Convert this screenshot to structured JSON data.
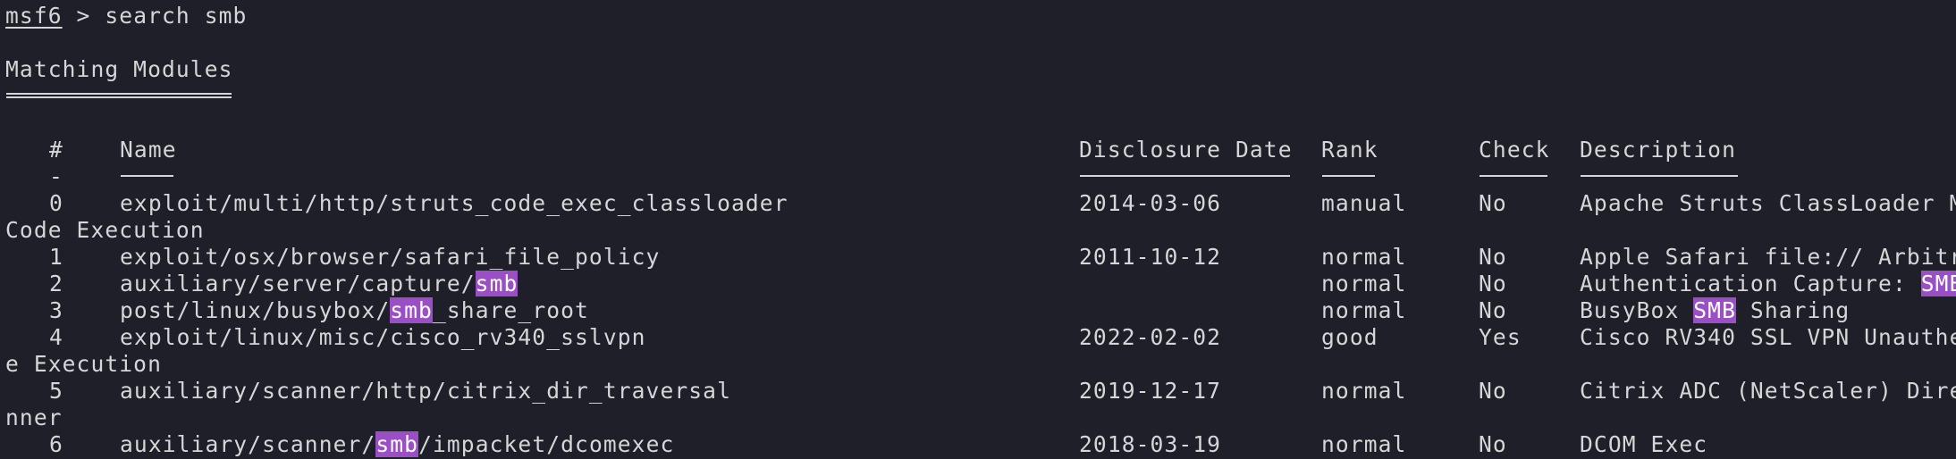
{
  "prompt": {
    "user": "msf6",
    "symbol": " > ",
    "command": "search smb"
  },
  "section_title": "Matching Modules",
  "headers": {
    "num": "#",
    "name": "Name",
    "date": "Disclosure Date",
    "rank": "Rank",
    "check": "Check",
    "description": "Description"
  },
  "header_dash": "-",
  "rows": [
    {
      "num": "0",
      "name_pre": "exploit/multi/http/struts_code_exec_classloader",
      "name_hl": "",
      "name_post": "",
      "date": "2014-03-06",
      "rank": "manual",
      "check": "No",
      "desc_pre": "Apache Struts ClassLoader M",
      "desc_hl": "",
      "desc_post": "",
      "wrap": "Code Execution"
    },
    {
      "num": "1",
      "name_pre": "exploit/osx/browser/safari_file_policy",
      "name_hl": "",
      "name_post": "",
      "date": "2011-10-12",
      "rank": "normal",
      "check": "No",
      "desc_pre": "Apple Safari file:// Arbitr",
      "desc_hl": "",
      "desc_post": "",
      "wrap": ""
    },
    {
      "num": "2",
      "name_pre": "auxiliary/server/capture/",
      "name_hl": "smb",
      "name_post": "",
      "date": "",
      "rank": "normal",
      "check": "No",
      "desc_pre": "Authentication Capture: ",
      "desc_hl": "SMB",
      "desc_post": "",
      "wrap": ""
    },
    {
      "num": "3",
      "name_pre": "post/linux/busybox/",
      "name_hl": "smb",
      "name_post": "_share_root",
      "date": "",
      "rank": "normal",
      "check": "No",
      "desc_pre": "BusyBox ",
      "desc_hl": "SMB",
      "desc_post": " Sharing",
      "wrap": ""
    },
    {
      "num": "4",
      "name_pre": "exploit/linux/misc/cisco_rv340_sslvpn",
      "name_hl": "",
      "name_post": "",
      "date": "2022-02-02",
      "rank": "good",
      "check": "Yes",
      "desc_pre": "Cisco RV340 SSL VPN Unauthe",
      "desc_hl": "",
      "desc_post": "",
      "wrap": "e Execution"
    },
    {
      "num": "5",
      "name_pre": "auxiliary/scanner/http/citrix_dir_traversal",
      "name_hl": "",
      "name_post": "",
      "date": "2019-12-17",
      "rank": "normal",
      "check": "No",
      "desc_pre": "Citrix ADC (NetScaler) Dire",
      "desc_hl": "",
      "desc_post": "",
      "wrap": "nner"
    },
    {
      "num": "6",
      "name_pre": "auxiliary/scanner/",
      "name_hl": "smb",
      "name_post": "/impacket/dcomexec",
      "date": "2018-03-19",
      "rank": "normal",
      "check": "No",
      "desc_pre": "DCOM Exec",
      "desc_hl": "",
      "desc_post": "",
      "wrap": ""
    }
  ],
  "colors": {
    "background": "#1e1f29",
    "foreground": "#d6d6d6",
    "highlight": "#9b4fc4"
  }
}
